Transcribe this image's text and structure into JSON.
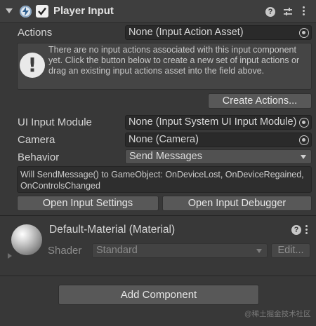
{
  "component": {
    "title": "Player Input",
    "enabled": true
  },
  "actions": {
    "label": "Actions",
    "value": "None (Input Action Asset)"
  },
  "help_box": {
    "icon": "!",
    "text": "There are no input actions associated with this input component yet. Click the button below to create a new set of input actions or drag an existing input actions asset into the field above."
  },
  "create_actions_button": "Create Actions...",
  "ui_input_module": {
    "label": "UI Input Module",
    "value": "None (Input System UI Input Module)"
  },
  "camera": {
    "label": "Camera",
    "value": "None (Camera)"
  },
  "behavior": {
    "label": "Behavior",
    "value": "Send Messages"
  },
  "behavior_message": "Will SendMessage() to GameObject: OnDeviceLost, OnDeviceRegained, OnControlsChanged",
  "buttons": {
    "open_settings": "Open Input Settings",
    "open_debugger": "Open Input Debugger"
  },
  "material": {
    "title": "Default-Material (Material)",
    "shader_label": "Shader",
    "shader_value": "Standard",
    "edit_button": "Edit..."
  },
  "add_component_button": "Add Component",
  "watermark": "@稀土掘金技术社区",
  "icons": {
    "foldout": "foldout-arrow-icon",
    "component": "player-input-icon",
    "help": "help-icon",
    "presets": "presets-icon",
    "menu": "kebab-menu-icon",
    "object_picker": "object-picker-icon",
    "info": "info-exclamation-icon",
    "dropdown": "dropdown-arrow-icon"
  }
}
